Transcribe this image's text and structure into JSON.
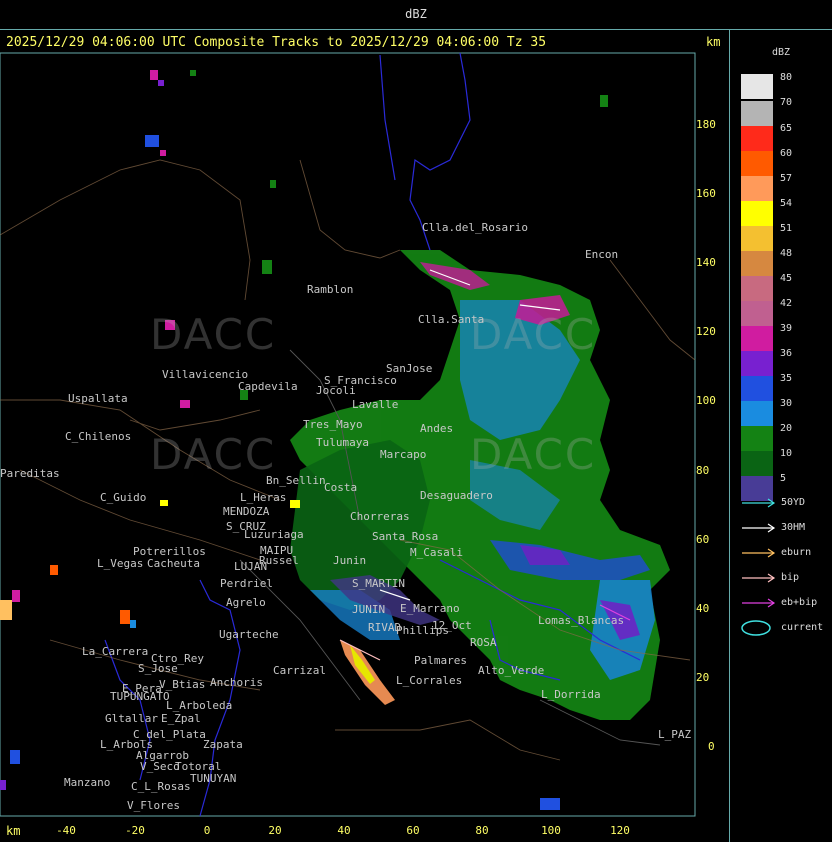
{
  "top": {
    "label": "dBZ"
  },
  "header": {
    "text": "2025/12/29 04:06:00 UTC Composite Tracks to 2025/12/29 04:06:00 Tz 35",
    "unit": "km"
  },
  "axes": {
    "unit": "km",
    "y_ticks": [
      "180",
      "160",
      "140",
      "120",
      "100",
      "80",
      "60",
      "40",
      "20",
      "0"
    ],
    "x_ticks": [
      "-40",
      "-20",
      "0",
      "20",
      "40",
      "60",
      "80",
      "100",
      "120"
    ]
  },
  "legend": {
    "title": "dBZ",
    "levels": [
      {
        "label": "80",
        "color": "#e6e6e6"
      },
      {
        "label": "70",
        "color": "#b4b4b4"
      },
      {
        "label": "65",
        "color": "#ff2a1a"
      },
      {
        "label": "60",
        "color": "#ff5a00"
      },
      {
        "label": "57",
        "color": "#ff9a5a"
      },
      {
        "label": "54",
        "color": "#ffff00"
      },
      {
        "label": "51",
        "color": "#f4c030"
      },
      {
        "label": "48",
        "color": "#d68840"
      },
      {
        "label": "45",
        "color": "#c86a80"
      },
      {
        "label": "42",
        "color": "#c06090"
      },
      {
        "label": "39",
        "color": "#d01ca0"
      },
      {
        "label": "36",
        "color": "#7820d0"
      },
      {
        "label": "35",
        "color": "#2050e0"
      },
      {
        "label": "30",
        "color": "#1a8ce0"
      },
      {
        "label": "20",
        "color": "#148214"
      },
      {
        "label": "10",
        "color": "#0a6414"
      },
      {
        "label": "5",
        "color": "#483c96"
      }
    ],
    "tracks": [
      {
        "label": "50YD",
        "color": "#40e0e0"
      },
      {
        "label": "30HM",
        "color": "#ffffff"
      },
      {
        "label": "eburn",
        "color": "#ffc060"
      },
      {
        "label": "bip",
        "color": "#ffc0c0"
      },
      {
        "label": "eb+bip",
        "color": "#e040e0"
      },
      {
        "label": "current",
        "color": "#40e0e0"
      }
    ]
  },
  "watermarks": [
    "DACC",
    "DACC",
    "DACC",
    "DACC"
  ],
  "places": [
    "Clla.del_Rosario",
    "Encon",
    "Ramblon",
    "Clla.Santa",
    "SanJose",
    "S_Francisco",
    "Villavicencio",
    "Uspallata",
    "C_Chilenos",
    "Tres_Mayo",
    "Tulumaya",
    "Jocoli",
    "C_Guido",
    "MENDOZA",
    "S_CRUZ",
    "Luzuriaga",
    "MAIPU",
    "Russel",
    "LUJAN",
    "Potrerillos",
    "Cacheuta",
    "L_Vegas",
    "Perdriel",
    "Agrelo",
    "Ugarteche",
    "S_MARTIN",
    "JUNIN",
    "RIVAD",
    "Phillips",
    "12_Oct",
    "ROSA",
    "Lomas_Blancas",
    "L_Dorrida",
    "L_PAZ",
    "La_Carrera",
    "Ctro_Rey",
    "S_Jose",
    "V_Btias",
    "E_Pera",
    "TUPUNGATO",
    "Anchoris",
    "Carrizal",
    "L_Arboleda",
    "Gltallar",
    "E_Zpal",
    "L_Arbols",
    "Zapata",
    "Manzano",
    "TUNUYAN",
    "V_Seco",
    "Algarrob",
    "Totoral",
    "C_L_Rosas",
    "V_Flores",
    "L_Heras",
    "Lavalle",
    "Andes",
    "Marcapo",
    "Capdevila",
    "Bn_Sellin",
    "Costa",
    "Santa_Rosa",
    "M_Casali",
    "Desaguadero",
    "Junin",
    "E_Marrano",
    "Palmares",
    "Chorreras",
    "L_Corrales",
    "Pareditas",
    "C_del_Plata",
    "Alto_Verde"
  ]
}
